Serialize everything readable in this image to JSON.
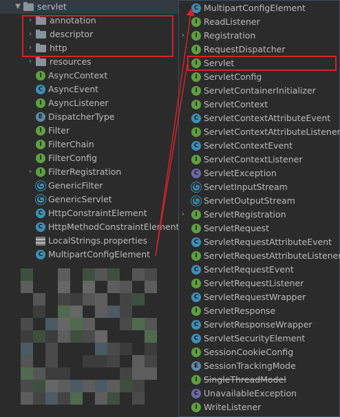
{
  "tree": {
    "root": {
      "label": "servlet"
    },
    "items": [
      {
        "kind": "folder",
        "label": "annotation",
        "expandable": true
      },
      {
        "kind": "folder",
        "label": "descriptor",
        "expandable": true
      },
      {
        "kind": "folder",
        "label": "http",
        "expandable": true
      },
      {
        "kind": "folder",
        "label": "resources",
        "expandable": true
      },
      {
        "kind": "class",
        "label": "AsyncContext",
        "icon": "interface-icon"
      },
      {
        "kind": "class",
        "label": "AsyncEvent",
        "icon": "class-icon"
      },
      {
        "kind": "class",
        "label": "AsyncListener",
        "icon": "interface-icon"
      },
      {
        "kind": "class",
        "label": "DispatcherType",
        "icon": "enum-icon"
      },
      {
        "kind": "class",
        "label": "Filter",
        "icon": "interface-icon"
      },
      {
        "kind": "class",
        "label": "FilterChain",
        "icon": "interface-icon"
      },
      {
        "kind": "class",
        "label": "FilterConfig",
        "icon": "interface-icon"
      },
      {
        "kind": "class",
        "label": "FilterRegistration",
        "icon": "interface-icon",
        "expandable": true
      },
      {
        "kind": "class",
        "label": "GenericFilter",
        "icon": "abstract-class-icon"
      },
      {
        "kind": "class",
        "label": "GenericServlet",
        "icon": "abstract-class-icon"
      },
      {
        "kind": "class",
        "label": "HttpConstraintElement",
        "icon": "class-icon"
      },
      {
        "kind": "class",
        "label": "HttpMethodConstraintElement",
        "icon": "class-icon"
      },
      {
        "kind": "class",
        "label": "LocalStrings.properties",
        "icon": "properties-file-icon"
      },
      {
        "kind": "class",
        "label": "MultipartConfigElement",
        "icon": "class-icon"
      }
    ]
  },
  "popup": {
    "items": [
      {
        "label": "MultipartConfigElement",
        "icon": "class-icon"
      },
      {
        "label": "ReadListener",
        "icon": "interface-icon"
      },
      {
        "label": "Registration",
        "icon": "interface-icon",
        "expandable": true
      },
      {
        "label": "RequestDispatcher",
        "icon": "interface-icon"
      },
      {
        "label": "Servlet",
        "icon": "interface-icon",
        "highlighted": true
      },
      {
        "label": "ServletConfig",
        "icon": "interface-icon"
      },
      {
        "label": "ServletContainerInitializer",
        "icon": "interface-icon"
      },
      {
        "label": "ServletContext",
        "icon": "interface-icon"
      },
      {
        "label": "ServletContextAttributeEvent",
        "icon": "class-icon"
      },
      {
        "label": "ServletContextAttributeListener",
        "icon": "interface-icon"
      },
      {
        "label": "ServletContextEvent",
        "icon": "class-icon"
      },
      {
        "label": "ServletContextListener",
        "icon": "interface-icon"
      },
      {
        "label": "ServletException",
        "icon": "exception-icon"
      },
      {
        "label": "ServletInputStream",
        "icon": "abstract-class-icon"
      },
      {
        "label": "ServletOutputStream",
        "icon": "abstract-class-icon"
      },
      {
        "label": "ServletRegistration",
        "icon": "interface-icon",
        "expandable": true
      },
      {
        "label": "ServletRequest",
        "icon": "interface-icon"
      },
      {
        "label": "ServletRequestAttributeEvent",
        "icon": "class-icon"
      },
      {
        "label": "ServletRequestAttributeListener",
        "icon": "interface-icon"
      },
      {
        "label": "ServletRequestEvent",
        "icon": "class-icon"
      },
      {
        "label": "ServletRequestListener",
        "icon": "interface-icon"
      },
      {
        "label": "ServletRequestWrapper",
        "icon": "class-icon"
      },
      {
        "label": "ServletResponse",
        "icon": "interface-icon"
      },
      {
        "label": "ServletResponseWrapper",
        "icon": "class-icon"
      },
      {
        "label": "ServletSecurityElement",
        "icon": "class-icon"
      },
      {
        "label": "SessionCookieConfig",
        "icon": "interface-icon"
      },
      {
        "label": "SessionTrackingMode",
        "icon": "enum-icon"
      },
      {
        "label": "SingleThreadModel",
        "icon": "interface-icon",
        "deprecated": true
      },
      {
        "label": "UnavailableException",
        "icon": "exception-icon"
      },
      {
        "label": "WriteListener",
        "icon": "interface-icon"
      }
    ]
  },
  "colors": {
    "annotation_box": "#d2232a",
    "arrow": "#d2232a",
    "popup_border": "#3c4d66"
  }
}
